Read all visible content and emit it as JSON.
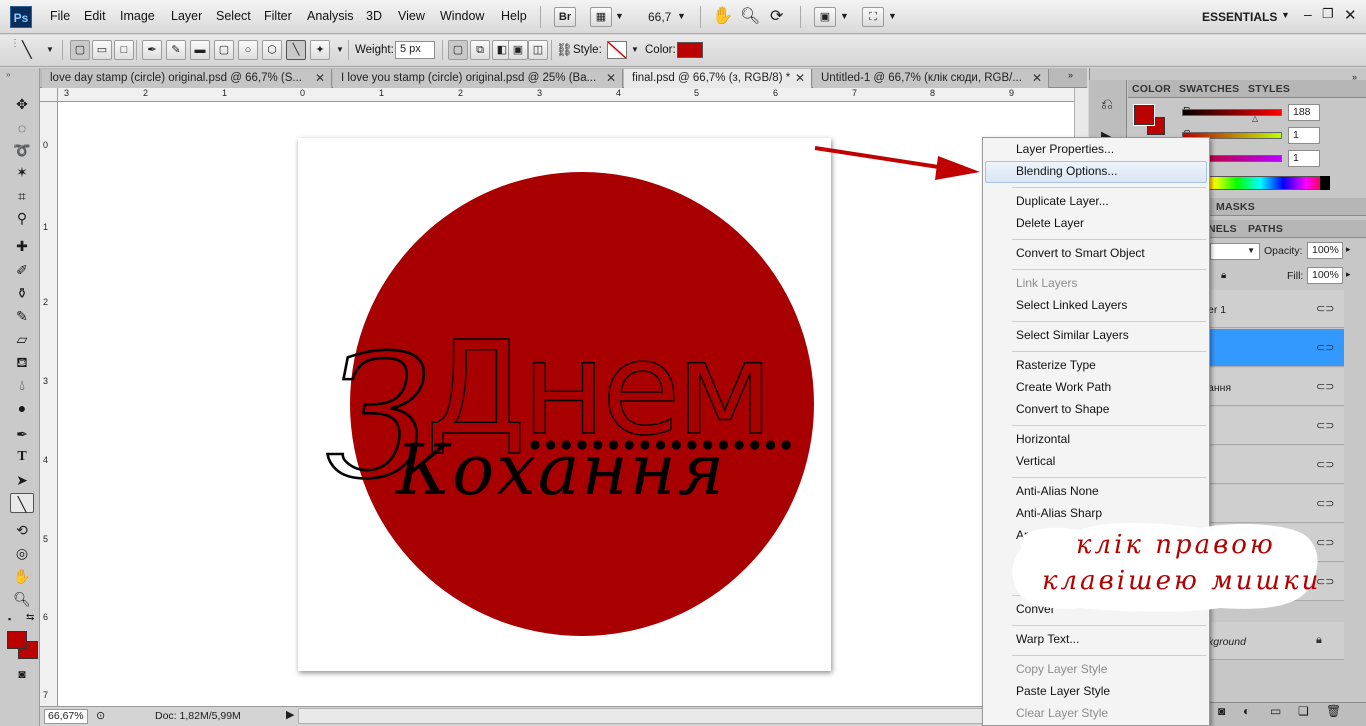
{
  "app": {
    "logo": "Ps",
    "workspace": "ESSENTIALS",
    "zoom_dropdown": "66,7"
  },
  "menu": [
    "File",
    "Edit",
    "Image",
    "Layer",
    "Select",
    "Filter",
    "Analysis",
    "3D",
    "View",
    "Window",
    "Help"
  ],
  "app_buttons": {
    "bridge": "Br"
  },
  "options": {
    "weight_label": "Weight:",
    "weight_value": "5 px",
    "style_label": "Style:",
    "color_label": "Color:",
    "color_hex": "#bc0101"
  },
  "tabs": [
    {
      "label": "love day stamp (circle) original.psd @ 66,7% (S...",
      "active": false
    },
    {
      "label": "I love you stamp (circle) original.psd @ 25% (Ba...",
      "active": false
    },
    {
      "label": "final.psd @ 66,7% (з, RGB/8) *",
      "active": true
    },
    {
      "label": "Untitled-1 @ 66,7% (клік сюди, RGB/...",
      "active": false
    }
  ],
  "ruler_top": [
    "3",
    "2",
    "1",
    "0",
    "1",
    "2",
    "3",
    "4",
    "5",
    "6",
    "7",
    "8",
    "9"
  ],
  "ruler_left": [
    "0",
    "1",
    "2",
    "3",
    "4",
    "5",
    "6",
    "7"
  ],
  "status": {
    "zoom": "66,67%",
    "doc": "Doc: 1,82M/5,99M"
  },
  "canvas_art": {
    "circle_color": "#a80000",
    "line1": "Днем",
    "prefix": "З",
    "line2": "Кохання"
  },
  "color_panel": {
    "tabs": [
      "COLOR",
      "SWATCHES",
      "STYLES"
    ],
    "channels": [
      {
        "label": "R",
        "value": "188"
      },
      {
        "label": "G",
        "value": "1"
      },
      {
        "label": "B",
        "value": "1"
      }
    ]
  },
  "adjust_tabs": [
    "MASKS"
  ],
  "layers_tabs": [
    "NELS",
    "PATHS"
  ],
  "layers": {
    "opacity_label": "Opacity:",
    "opacity_value": "100%",
    "fill_label": "Fill:",
    "fill_value": "100%",
    "rows": [
      {
        "name": "er 1",
        "selected": false
      },
      {
        "name": "",
        "selected": true
      },
      {
        "name": "ання",
        "selected": false
      },
      {
        "name": "",
        "selected": false
      },
      {
        "name": "",
        "selected": false
      },
      {
        "name": "",
        "selected": false
      },
      {
        "name": "",
        "selected": false
      },
      {
        "name": "",
        "selected": false
      },
      {
        "name": "kground",
        "selected": false
      }
    ]
  },
  "context_menu": [
    {
      "label": "Layer Properties...",
      "disabled": false
    },
    {
      "label": "Blending Options...",
      "disabled": false,
      "highlighted": true
    },
    {
      "label": "Duplicate Layer...",
      "disabled": false
    },
    {
      "label": "Delete Layer",
      "disabled": false
    },
    {
      "label": "Convert to Smart Object",
      "disabled": false
    },
    {
      "label": "Link Layers",
      "disabled": true
    },
    {
      "label": "Select Linked Layers",
      "disabled": false
    },
    {
      "label": "Select Similar Layers",
      "disabled": false
    },
    {
      "label": "Rasterize Type",
      "disabled": false
    },
    {
      "label": "Create Work Path",
      "disabled": false
    },
    {
      "label": "Convert to Shape",
      "disabled": false
    },
    {
      "label": "Horizontal",
      "disabled": false
    },
    {
      "label": "Vertical",
      "disabled": false
    },
    {
      "label": "Anti-Alias None",
      "disabled": false
    },
    {
      "label": "Anti-Alias Sharp",
      "disabled": false
    },
    {
      "label": "Anti-Ali",
      "disabled": false
    },
    {
      "label": "Conver",
      "disabled": false
    },
    {
      "label": "Warp Text...",
      "disabled": false
    },
    {
      "label": "Copy Layer Style",
      "disabled": true
    },
    {
      "label": "Paste Layer Style",
      "disabled": false
    },
    {
      "label": "Clear Layer Style",
      "disabled": true
    }
  ],
  "annotation": {
    "line1": "клік правою",
    "line2": "клавішею мишки",
    "color": "#b40000"
  }
}
